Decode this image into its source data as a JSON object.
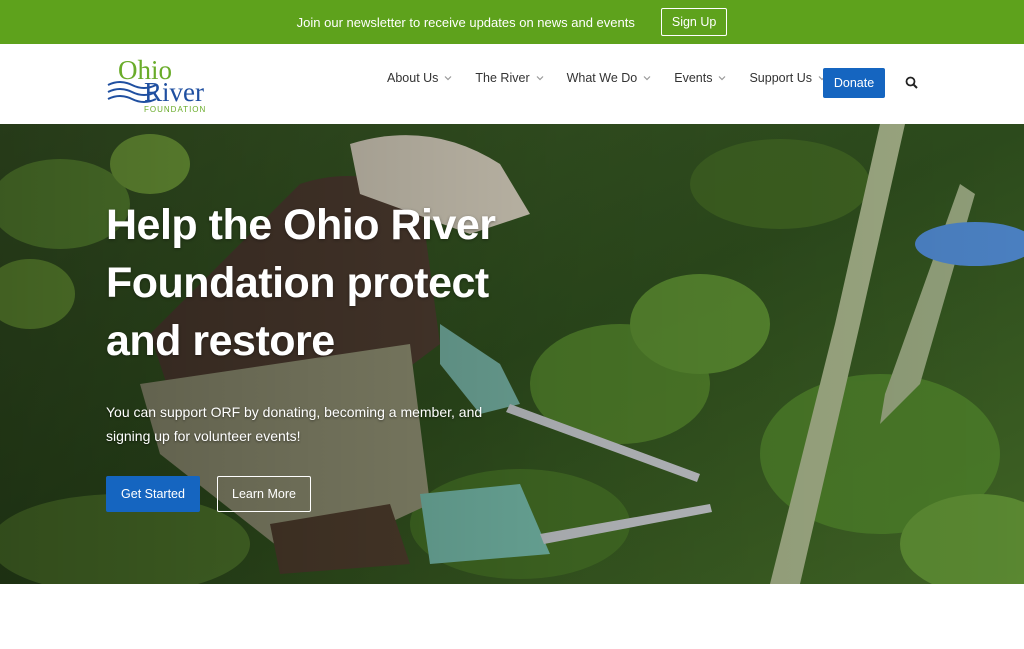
{
  "topbar": {
    "message": "Join our newsletter to receive updates on news and events",
    "signup_label": "Sign Up",
    "color": "#5ea21c"
  },
  "header": {
    "logo": {
      "line1": "Ohio",
      "line2": "River",
      "line3": "FOUNDATION"
    },
    "nav": [
      {
        "label": "About Us"
      },
      {
        "label": "The River"
      },
      {
        "label": "What We Do"
      },
      {
        "label": "Events"
      },
      {
        "label": "Support Us"
      }
    ],
    "donate_label": "Donate",
    "accent": "#1565c0"
  },
  "hero": {
    "title": "Help the Ohio River Foundation protect and restore",
    "subtitle": "You can support ORF by donating, becoming a member, and signing up for volunteer events!",
    "get_started_label": "Get Started",
    "learn_more_label": "Learn More"
  }
}
